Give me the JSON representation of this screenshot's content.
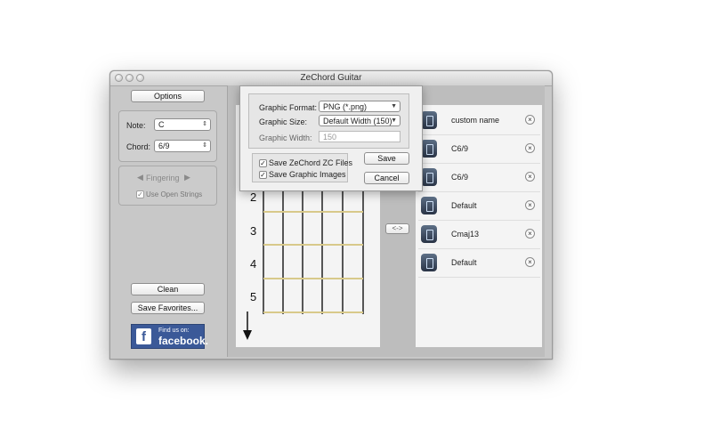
{
  "window": {
    "title": "ZeChord Guitar"
  },
  "sidebar": {
    "options_label": "Options",
    "note_label": "Note:",
    "note_value": "C",
    "chord_label": "Chord:",
    "chord_value": "6/9",
    "fingering_label": "Fingering",
    "use_open_strings_label": "Use Open Strings",
    "clean_label": "Clean",
    "save_favorites_label": "Save Favorites...",
    "facebook_line1": "Find us on:",
    "facebook_line2": "facebook."
  },
  "fretboard": {
    "fret_numbers": [
      "2",
      "3",
      "4",
      "5"
    ]
  },
  "swap_label": "<->",
  "favorites": [
    {
      "name": "custom name"
    },
    {
      "name": "C6/9"
    },
    {
      "name": "C6/9"
    },
    {
      "name": "Default"
    },
    {
      "name": "Cmaj13"
    },
    {
      "name": "Default"
    }
  ],
  "export_dialog": {
    "format_label": "Graphic Format:",
    "format_value": "PNG (*.png)",
    "size_label": "Graphic Size:",
    "size_value": "Default Width (150)",
    "width_label": "Graphic Width:",
    "width_value": "150",
    "save_zc_label": "Save ZeChord ZC Files",
    "save_images_label": "Save Graphic Images",
    "save_label": "Save",
    "cancel_label": "Cancel"
  }
}
